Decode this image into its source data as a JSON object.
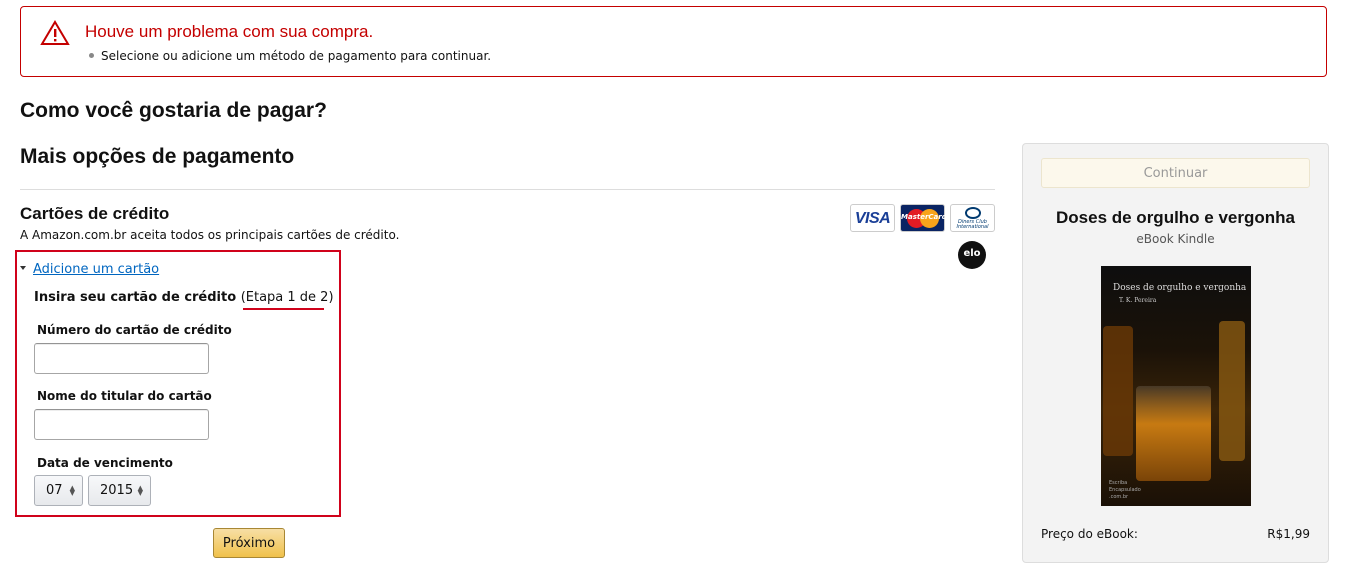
{
  "alert": {
    "title": "Houve um problema com sua compra.",
    "message": "Selecione ou adicione um método de pagamento para continuar.",
    "icon": "warning-icon",
    "color": "#c40000"
  },
  "headings": {
    "question": "Como você gostaria de pagar?",
    "more_options": "Mais opções de pagamento"
  },
  "credit_cards": {
    "title": "Cartões de crédito",
    "description": "A Amazon.com.br aceita todos os principais cartões de crédito.",
    "brands": {
      "visa": "VISA",
      "mastercard": "MasterCard",
      "diners": "Diners Club International",
      "elo": "elo"
    },
    "add_card_link": "Adicione um cartão"
  },
  "form": {
    "title": "Insira seu cartão de crédito",
    "step_text": "(Etapa 1 de 2)",
    "card_number_label": "Número do cartão de crédito",
    "card_number_value": "",
    "holder_label": "Nome do titular do cartão",
    "holder_value": "",
    "expiry_label": "Data de vencimento",
    "month": "07",
    "year": "2015",
    "next_button": "Próximo"
  },
  "sidebar": {
    "continue_button": "Continuar",
    "book_title": "Doses de orgulho e vergonha",
    "book_format": "eBook Kindle",
    "cover": {
      "title": "Doses de orgulho e vergonha",
      "author": "T. K. Pereira",
      "publisher_line1": "Escriba",
      "publisher_line2": "Encapsulado",
      "publisher_line3": ".com.br"
    },
    "price_label": "Preço do eBook:",
    "price_value": "R$1,99"
  },
  "colors": {
    "accent_red": "#d0021b",
    "link": "#0066c0",
    "button_yellow": "#f0c14b"
  }
}
